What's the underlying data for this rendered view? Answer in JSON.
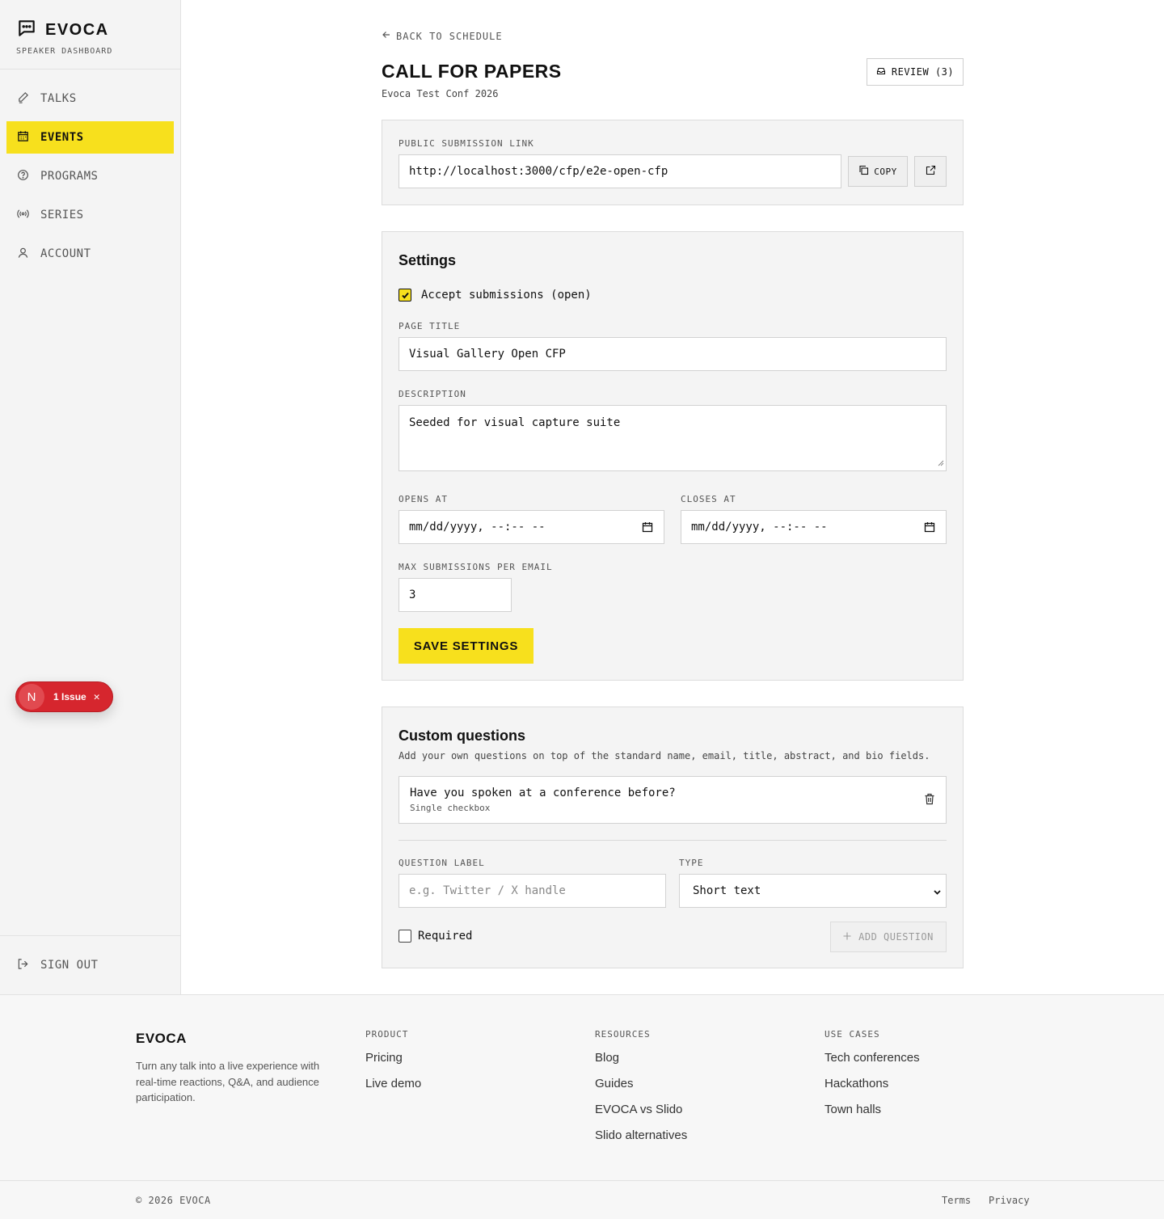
{
  "sidebar": {
    "brand": "EVOCA",
    "subtitle": "SPEAKER DASHBOARD",
    "items": [
      {
        "label": "TALKS",
        "icon": "pen-icon"
      },
      {
        "label": "EVENTS",
        "icon": "calendar-icon",
        "active": true
      },
      {
        "label": "PROGRAMS",
        "icon": "help-circle-icon"
      },
      {
        "label": "SERIES",
        "icon": "broadcast-icon"
      },
      {
        "label": "ACCOUNT",
        "icon": "user-icon"
      }
    ],
    "sign_out": "SIGN OUT"
  },
  "issue_badge": {
    "letter": "N",
    "text": "1 Issue"
  },
  "header": {
    "back": "BACK TO SCHEDULE",
    "title": "CALL FOR PAPERS",
    "subtitle": "Evoca Test Conf 2026",
    "review": "REVIEW (3)"
  },
  "link_card": {
    "label": "PUBLIC SUBMISSION LINK",
    "url": "http://localhost:3000/cfp/e2e-open-cfp",
    "copy": "COPY"
  },
  "settings": {
    "title": "Settings",
    "accept_label": "Accept submissions (open)",
    "accept_checked": true,
    "page_title_label": "PAGE TITLE",
    "page_title_value": "Visual Gallery Open CFP",
    "description_label": "DESCRIPTION",
    "description_value": "Seeded for visual capture suite",
    "opens_label": "OPENS AT",
    "opens_value": "mm/dd/yyyy, --:-- --",
    "closes_label": "CLOSES AT",
    "closes_value": "mm/dd/yyyy, --:-- --",
    "max_label": "MAX SUBMISSIONS PER EMAIL",
    "max_value": "3",
    "save": "SAVE SETTINGS"
  },
  "questions": {
    "title": "Custom questions",
    "description": "Add your own questions on top of the standard name, email, title, abstract, and bio fields.",
    "items": [
      {
        "label": "Have you spoken at a conference before?",
        "type": "Single checkbox"
      }
    ],
    "label_field": "QUESTION LABEL",
    "label_placeholder": "e.g. Twitter / X handle",
    "type_field": "TYPE",
    "type_value": "Short text",
    "required_label": "Required",
    "add": "ADD QUESTION"
  },
  "footer": {
    "brand": "EVOCA",
    "description": "Turn any talk into a live experience with real-time reactions, Q&A, and audience participation.",
    "columns": [
      {
        "title": "PRODUCT",
        "links": [
          "Pricing",
          "Live demo"
        ]
      },
      {
        "title": "RESOURCES",
        "links": [
          "Blog",
          "Guides",
          "EVOCA vs Slido",
          "Slido alternatives"
        ]
      },
      {
        "title": "USE CASES",
        "links": [
          "Tech conferences",
          "Hackathons",
          "Town halls"
        ]
      }
    ],
    "copyright": "© 2026 EVOCA",
    "terms": "Terms",
    "privacy": "Privacy"
  },
  "colors": {
    "accent": "#f7e01d",
    "issue": "#d6262e"
  }
}
